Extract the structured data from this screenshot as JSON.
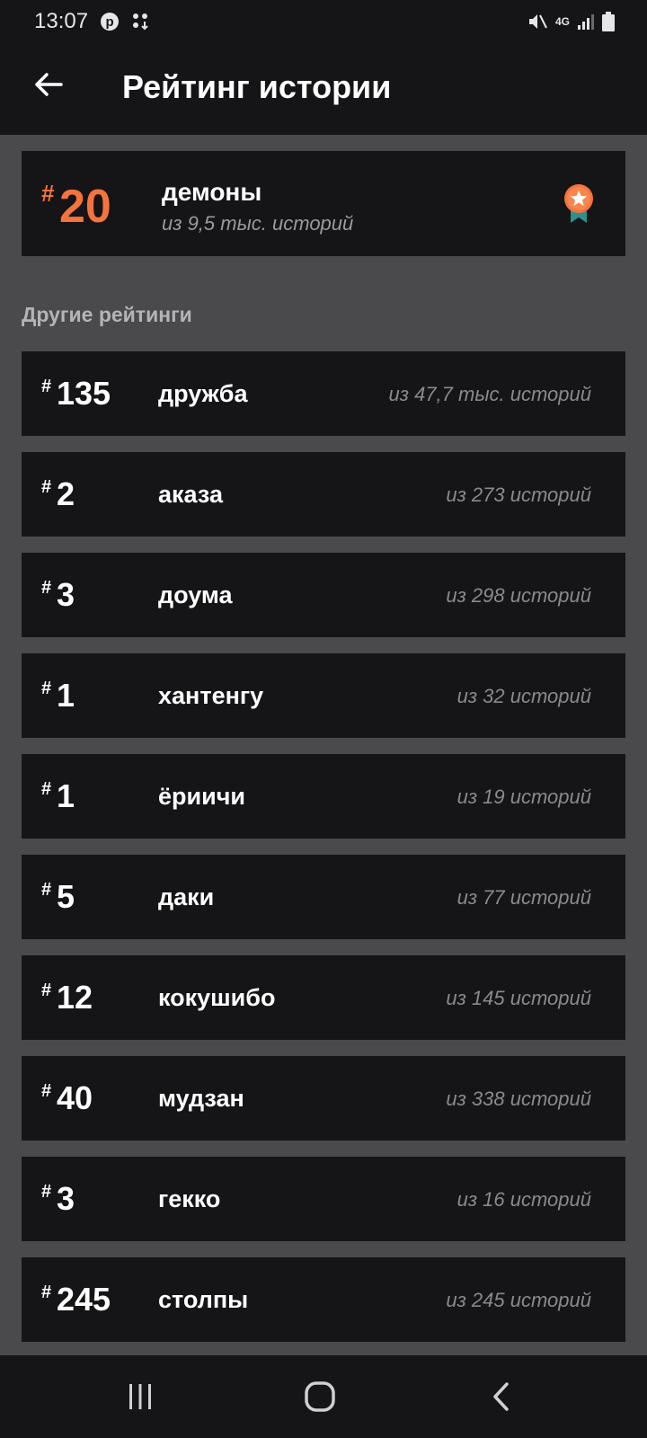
{
  "status_bar": {
    "time": "13:07",
    "network": "4G"
  },
  "header": {
    "title": "Рейтинг истории"
  },
  "top_rating": {
    "hash": "#",
    "rank": "20",
    "name": "демоны",
    "subtitle": "из 9,5 тыс. историй",
    "accent_color": "#f5733d"
  },
  "other_ratings": {
    "title": "Другие рейтинги",
    "items": [
      {
        "hash": "#",
        "rank": "135",
        "name": "дружба",
        "count": "из 47,7 тыс. историй"
      },
      {
        "hash": "#",
        "rank": "2",
        "name": "аказа",
        "count": "из 273 историй"
      },
      {
        "hash": "#",
        "rank": "3",
        "name": "доума",
        "count": "из 298 историй"
      },
      {
        "hash": "#",
        "rank": "1",
        "name": "хантенгу",
        "count": "из 32 историй"
      },
      {
        "hash": "#",
        "rank": "1",
        "name": "ёриичи",
        "count": "из 19 историй"
      },
      {
        "hash": "#",
        "rank": "5",
        "name": "даки",
        "count": "из 77 историй"
      },
      {
        "hash": "#",
        "rank": "12",
        "name": "кокушибо",
        "count": "из 145 историй"
      },
      {
        "hash": "#",
        "rank": "40",
        "name": "мудзан",
        "count": "из 338 историй"
      },
      {
        "hash": "#",
        "rank": "3",
        "name": "гекко",
        "count": "из 16 историй"
      },
      {
        "hash": "#",
        "rank": "245",
        "name": "столпы",
        "count": "из 245 историй"
      }
    ]
  },
  "icons": {
    "back": "arrow-left-icon",
    "badge": "ribbon-star-badge-icon",
    "nav_recents": "recents-icon",
    "nav_home": "home-icon",
    "nav_back": "chevron-left-icon"
  }
}
